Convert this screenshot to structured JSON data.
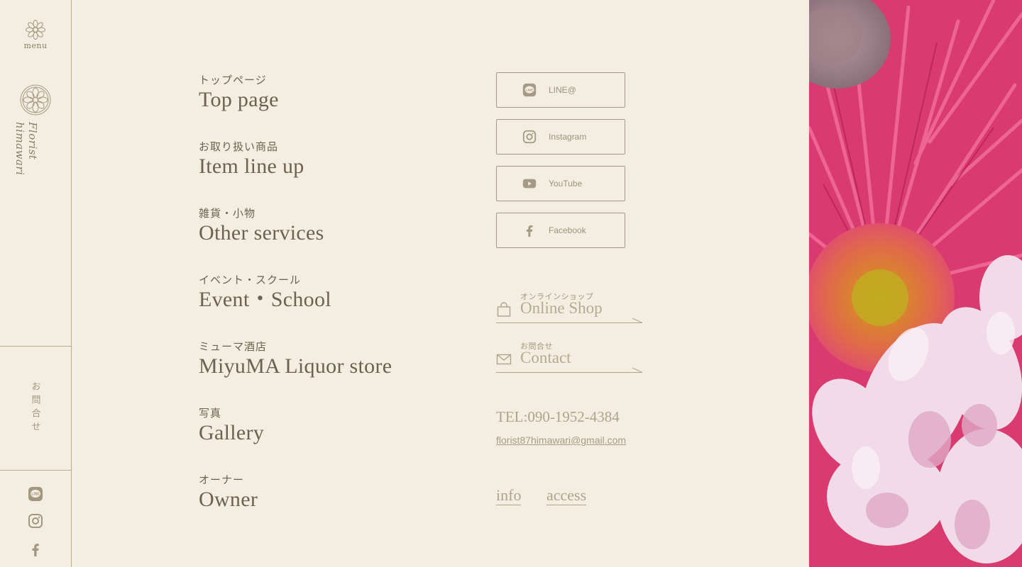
{
  "sidebar": {
    "menu_label": "menu",
    "logo_text": "Florist himawari",
    "contact_label": "お問合せ",
    "icons": [
      "line-icon",
      "instagram-icon",
      "facebook-icon"
    ]
  },
  "nav": {
    "items": [
      {
        "jp": "トップページ",
        "en": "Top page"
      },
      {
        "jp": "お取り扱い商品",
        "en": "Item line up"
      },
      {
        "jp": "雑貨・小物",
        "en": "Other services"
      },
      {
        "jp": "イベント・スクール",
        "en": "Event・School"
      },
      {
        "jp": "ミューマ酒店",
        "en": "MiyuMA Liquor store"
      },
      {
        "jp": "写真",
        "en": "Gallery"
      },
      {
        "jp": "オーナー",
        "en": "Owner"
      }
    ]
  },
  "sns": {
    "line": "LINE@",
    "instagram": "Instagram",
    "youtube": "YouTube",
    "facebook": "Facebook"
  },
  "links": {
    "shop_small": "オンラインショップ",
    "shop_big": "Online Shop",
    "contact_small": "お問合せ",
    "contact_big": "Contact"
  },
  "contact": {
    "tel": "TEL:090-1952-4384",
    "email": "florist87himawari@gmail.com"
  },
  "footer": {
    "info": "info",
    "access": "access"
  },
  "colors": {
    "background": "#f4ede1",
    "text": "#6e6150",
    "muted": "#b0a38b",
    "border": "#a59a85"
  }
}
